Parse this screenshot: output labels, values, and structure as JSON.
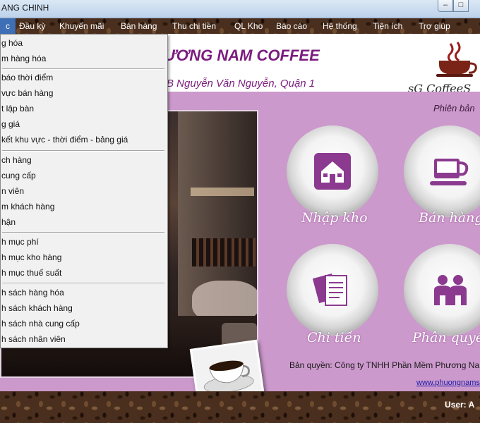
{
  "window": {
    "title": "ANG CHINH",
    "minimize_glyph": "–",
    "maximize_glyph": "□"
  },
  "menubar": {
    "items": [
      {
        "label": "c"
      },
      {
        "label": "Đầu kỳ"
      },
      {
        "label": "Khuyến mãi"
      },
      {
        "label": "Bán hàng"
      },
      {
        "label": "Thu chi tiền"
      },
      {
        "label": "QL Kho"
      },
      {
        "label": "Báo cáo"
      },
      {
        "label": "Hệ thống"
      },
      {
        "label": "Tiện ích"
      },
      {
        "label": "Trợ giúp"
      }
    ]
  },
  "dropdown": {
    "items": [
      {
        "label": "g hóa"
      },
      {
        "label": "m hàng hóa"
      },
      {
        "label": " báo thời điểm"
      },
      {
        "label": " vực bán hàng"
      },
      {
        "label": "t lập bàn"
      },
      {
        "label": "g giá"
      },
      {
        "label": " kết khu vực - thời điểm - bảng giá"
      },
      {
        "label": "ch hàng"
      },
      {
        "label": " cung cấp"
      },
      {
        "label": "n viên"
      },
      {
        "label": "m khách hàng"
      },
      {
        "label": "hận"
      },
      {
        "label": "h mục phí"
      },
      {
        "label": "h mục kho hàng"
      },
      {
        "label": "h mục thuế suất"
      },
      {
        "label": "h sách hàng hóa"
      },
      {
        "label": "h sách khách hàng"
      },
      {
        "label": "h sách nhà cung cấp"
      },
      {
        "label": "h sách nhân viên"
      }
    ]
  },
  "header": {
    "brand": "ƯƠNG NAM COFFEE",
    "address": "B Nguyễn Văn Nguyễn, Quận 1",
    "logo_text": "sG CoffeeS"
  },
  "main": {
    "version": "Phiên bản",
    "tiles": [
      {
        "label": "Nhập kho",
        "icon": "warehouse-icon"
      },
      {
        "label": "Bán hàng",
        "icon": "coffee-cup-icon"
      },
      {
        "label": "Chi tiền",
        "icon": "documents-icon"
      },
      {
        "label": "Phân quyền",
        "icon": "users-icon"
      }
    ],
    "copyright": "Bản quyền: Công ty TNHH Phần Mềm Phương Na",
    "website": "www.phuongnams"
  },
  "footer": {
    "user": "User: A"
  },
  "colors": {
    "accent": "#7b1c7f",
    "panel": "#cc99cc",
    "menu_highlight": "#3f6fb5",
    "tile_icon": "#8b3a8f"
  }
}
